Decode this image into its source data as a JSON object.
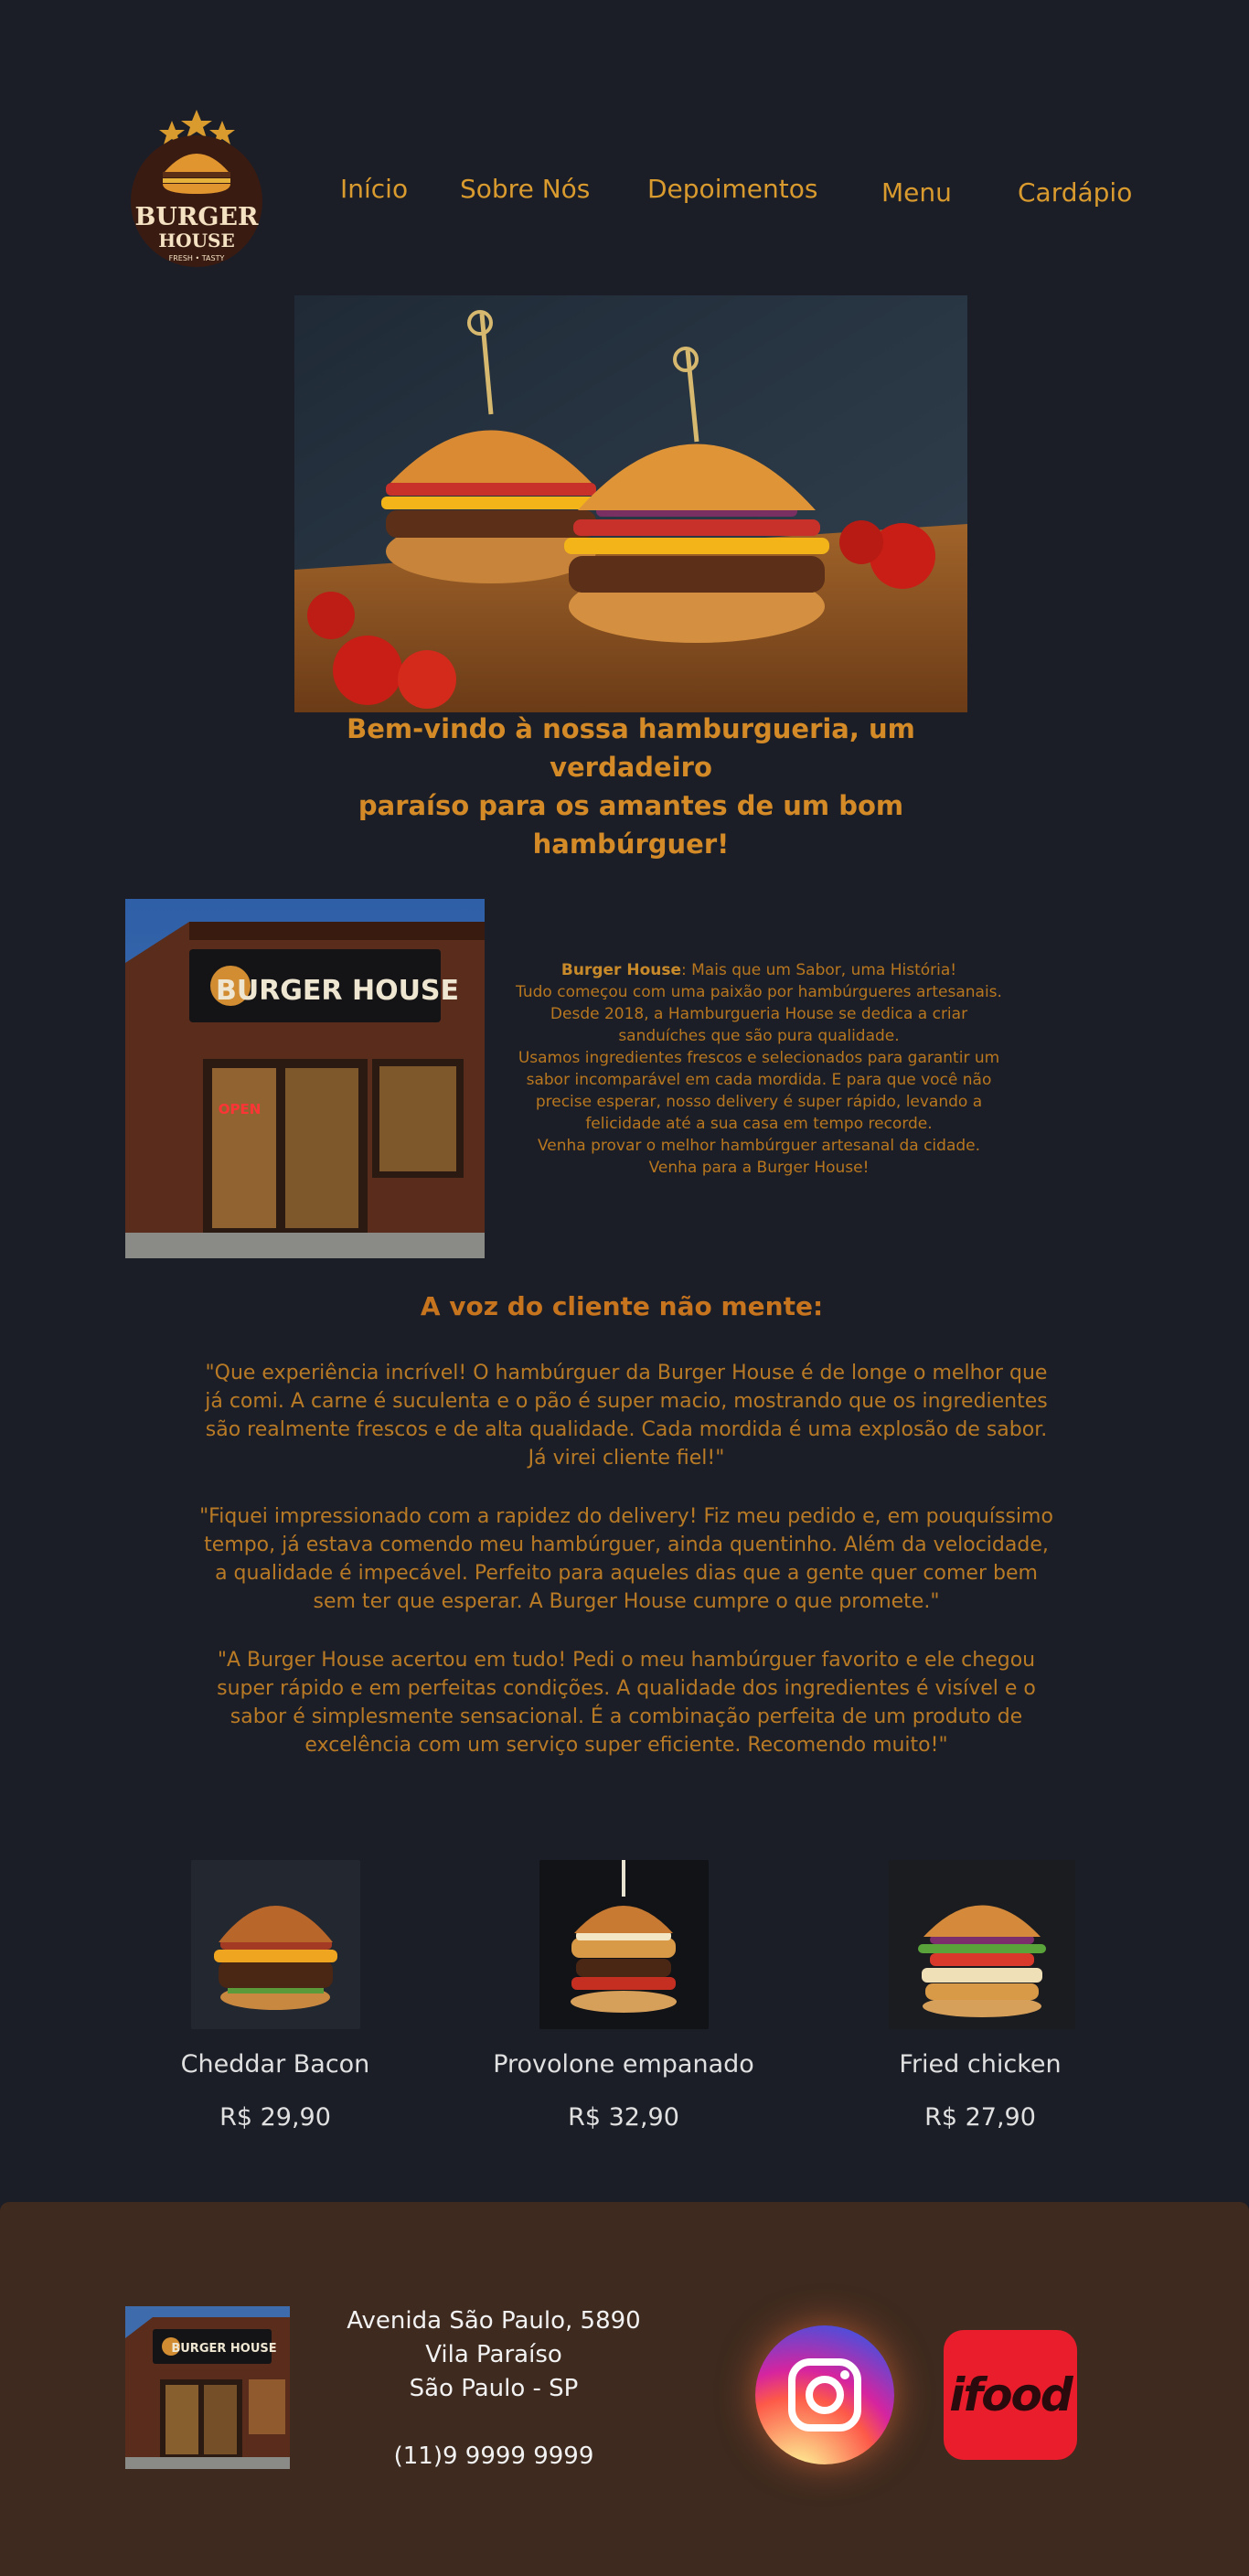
{
  "header": {
    "logo": {
      "line1": "BURGER",
      "line2": "HOUSE",
      "tagline": "FRESH • TASTY"
    },
    "nav": [
      {
        "label": "Início"
      },
      {
        "label": "Sobre Nós"
      },
      {
        "label": "Depoimentos"
      },
      {
        "label": "Menu"
      },
      {
        "label": "Cardápio"
      }
    ]
  },
  "hero": {
    "welcome_line1": "Bem-vindo à nossa hamburgueria, um verdadeiro",
    "welcome_line2": "paraíso para os amantes de um bom hambúrguer!"
  },
  "about": {
    "store_sign": "BURGER HOUSE",
    "open_sign": "OPEN",
    "brand": "Burger House",
    "lines": [
      ": Mais que um Sabor, uma História!",
      "Tudo começou com uma paixão por hambúrgueres artesanais.",
      "Desde 2018, a Hamburgueria House se dedica a criar",
      "sanduíches que são pura qualidade.",
      "Usamos ingredientes frescos e selecionados para garantir um",
      "sabor incomparável em cada mordida. E para que você não",
      "precise esperar, nosso delivery é super rápido, levando a",
      "felicidade até a sua casa em tempo recorde.",
      "Venha provar o melhor hambúrguer artesanal da cidade.",
      "Venha para a Burger House!"
    ]
  },
  "testimonials": {
    "title": "A voz do cliente não mente:",
    "items": [
      "\"Que experiência incrível! O hambúrguer da Burger House é de longe o melhor que já comi. A carne é suculenta e o pão é super macio, mostrando que os ingredientes são realmente frescos e de alta qualidade. Cada mordida é uma explosão de sabor. Já virei cliente fiel!\"",
      "\"Fiquei impressionado com a rapidez do delivery! Fiz meu pedido e, em pouquíssimo tempo, já estava comendo meu hambúrguer, ainda quentinho. Além da velocidade, a qualidade é impecável. Perfeito para aqueles dias que a gente quer comer bem sem ter que esperar. A Burger House cumpre o que promete.\"",
      "\"A Burger House acertou em tudo! Pedi o meu hambúrguer favorito e ele chegou super rápido e em perfeitas condições. A qualidade dos ingredientes é visível e o sabor é simplesmente sensacional. É a combinação perfeita de um produto de excelência com um serviço super eficiente. Recomendo muito!\""
    ]
  },
  "products": [
    {
      "name": "Cheddar Bacon",
      "price": "R$ 29,90"
    },
    {
      "name": "Provolone empanado",
      "price": "R$ 32,90"
    },
    {
      "name": "Fried chicken",
      "price": "R$ 27,90"
    }
  ],
  "footer": {
    "address_line1": "Avenida São Paulo, 5890",
    "address_line2": "Vila Paraíso",
    "address_line3": "São Paulo - SP",
    "phone": "(11)9 9999 9999",
    "ifood_label": "ifood"
  },
  "colors": {
    "background": "#1b1e27",
    "accent": "#d99a2e",
    "footer": "#3e2a1f",
    "ifood": "#ea1d2c"
  }
}
